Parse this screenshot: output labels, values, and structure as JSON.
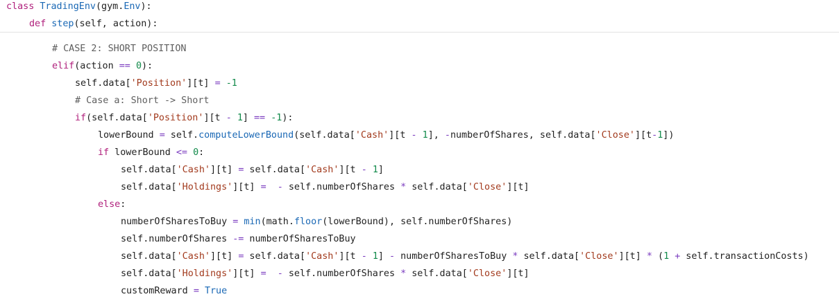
{
  "sticky_header": [
    {
      "indent": 0,
      "tokens": [
        {
          "t": "kw",
          "v": "class"
        },
        {
          "t": "tx",
          "v": " "
        },
        {
          "t": "fn",
          "v": "TradingEnv"
        },
        {
          "t": "tx",
          "v": "(gym."
        },
        {
          "t": "fn",
          "v": "Env"
        },
        {
          "t": "tx",
          "v": "):"
        }
      ]
    },
    {
      "indent": 1,
      "tokens": [
        {
          "t": "kw",
          "v": "def"
        },
        {
          "t": "tx",
          "v": " "
        },
        {
          "t": "fn",
          "v": "step"
        },
        {
          "t": "tx",
          "v": "(self, action):"
        }
      ]
    }
  ],
  "body_lines": [
    {
      "indent": 2,
      "tokens": [
        {
          "t": "cm",
          "v": "# CASE 2: SHORT POSITION"
        }
      ]
    },
    {
      "indent": 2,
      "tokens": [
        {
          "t": "kw",
          "v": "elif"
        },
        {
          "t": "tx",
          "v": "(action "
        },
        {
          "t": "op",
          "v": "=="
        },
        {
          "t": "tx",
          "v": " "
        },
        {
          "t": "num",
          "v": "0"
        },
        {
          "t": "tx",
          "v": "):"
        }
      ]
    },
    {
      "indent": 3,
      "tokens": [
        {
          "t": "tx",
          "v": "self.data["
        },
        {
          "t": "str",
          "v": "'Position'"
        },
        {
          "t": "tx",
          "v": "][t] "
        },
        {
          "t": "op",
          "v": "="
        },
        {
          "t": "tx",
          "v": " "
        },
        {
          "t": "num",
          "v": "-1"
        }
      ]
    },
    {
      "indent": 3,
      "tokens": [
        {
          "t": "cm",
          "v": "# Case a: Short -> Short"
        }
      ]
    },
    {
      "indent": 3,
      "tokens": [
        {
          "t": "kw",
          "v": "if"
        },
        {
          "t": "tx",
          "v": "(self.data["
        },
        {
          "t": "str",
          "v": "'Position'"
        },
        {
          "t": "tx",
          "v": "][t "
        },
        {
          "t": "op",
          "v": "-"
        },
        {
          "t": "tx",
          "v": " "
        },
        {
          "t": "num",
          "v": "1"
        },
        {
          "t": "tx",
          "v": "] "
        },
        {
          "t": "op",
          "v": "=="
        },
        {
          "t": "tx",
          "v": " "
        },
        {
          "t": "num",
          "v": "-1"
        },
        {
          "t": "tx",
          "v": "):"
        }
      ]
    },
    {
      "indent": 4,
      "tokens": [
        {
          "t": "tx",
          "v": "lowerBound "
        },
        {
          "t": "op",
          "v": "="
        },
        {
          "t": "tx",
          "v": " self."
        },
        {
          "t": "fn",
          "v": "computeLowerBound"
        },
        {
          "t": "tx",
          "v": "(self.data["
        },
        {
          "t": "str",
          "v": "'Cash'"
        },
        {
          "t": "tx",
          "v": "][t "
        },
        {
          "t": "op",
          "v": "-"
        },
        {
          "t": "tx",
          "v": " "
        },
        {
          "t": "num",
          "v": "1"
        },
        {
          "t": "tx",
          "v": "], "
        },
        {
          "t": "op",
          "v": "-"
        },
        {
          "t": "tx",
          "v": "numberOfShares, self.data["
        },
        {
          "t": "str",
          "v": "'Close'"
        },
        {
          "t": "tx",
          "v": "][t"
        },
        {
          "t": "op",
          "v": "-"
        },
        {
          "t": "num",
          "v": "1"
        },
        {
          "t": "tx",
          "v": "])"
        }
      ]
    },
    {
      "indent": 4,
      "tokens": [
        {
          "t": "kw",
          "v": "if"
        },
        {
          "t": "tx",
          "v": " lowerBound "
        },
        {
          "t": "op",
          "v": "<="
        },
        {
          "t": "tx",
          "v": " "
        },
        {
          "t": "num",
          "v": "0"
        },
        {
          "t": "tx",
          "v": ":"
        }
      ]
    },
    {
      "indent": 5,
      "tokens": [
        {
          "t": "tx",
          "v": "self.data["
        },
        {
          "t": "str",
          "v": "'Cash'"
        },
        {
          "t": "tx",
          "v": "][t] "
        },
        {
          "t": "op",
          "v": "="
        },
        {
          "t": "tx",
          "v": " self.data["
        },
        {
          "t": "str",
          "v": "'Cash'"
        },
        {
          "t": "tx",
          "v": "][t "
        },
        {
          "t": "op",
          "v": "-"
        },
        {
          "t": "tx",
          "v": " "
        },
        {
          "t": "num",
          "v": "1"
        },
        {
          "t": "tx",
          "v": "]"
        }
      ]
    },
    {
      "indent": 5,
      "tokens": [
        {
          "t": "tx",
          "v": "self.data["
        },
        {
          "t": "str",
          "v": "'Holdings'"
        },
        {
          "t": "tx",
          "v": "][t] "
        },
        {
          "t": "op",
          "v": "="
        },
        {
          "t": "tx",
          "v": "  "
        },
        {
          "t": "op",
          "v": "-"
        },
        {
          "t": "tx",
          "v": " self.numberOfShares "
        },
        {
          "t": "op",
          "v": "*"
        },
        {
          "t": "tx",
          "v": " self.data["
        },
        {
          "t": "str",
          "v": "'Close'"
        },
        {
          "t": "tx",
          "v": "][t]"
        }
      ]
    },
    {
      "indent": 4,
      "tokens": [
        {
          "t": "kw",
          "v": "else"
        },
        {
          "t": "tx",
          "v": ":"
        }
      ]
    },
    {
      "indent": 5,
      "tokens": [
        {
          "t": "tx",
          "v": "numberOfSharesToBuy "
        },
        {
          "t": "op",
          "v": "="
        },
        {
          "t": "tx",
          "v": " "
        },
        {
          "t": "fn",
          "v": "min"
        },
        {
          "t": "tx",
          "v": "(math."
        },
        {
          "t": "fn",
          "v": "floor"
        },
        {
          "t": "tx",
          "v": "(lowerBound), self.numberOfShares)"
        }
      ]
    },
    {
      "indent": 5,
      "tokens": [
        {
          "t": "tx",
          "v": "self.numberOfShares "
        },
        {
          "t": "op",
          "v": "-="
        },
        {
          "t": "tx",
          "v": " numberOfSharesToBuy"
        }
      ]
    },
    {
      "indent": 5,
      "tokens": [
        {
          "t": "tx",
          "v": "self.data["
        },
        {
          "t": "str",
          "v": "'Cash'"
        },
        {
          "t": "tx",
          "v": "][t] "
        },
        {
          "t": "op",
          "v": "="
        },
        {
          "t": "tx",
          "v": " self.data["
        },
        {
          "t": "str",
          "v": "'Cash'"
        },
        {
          "t": "tx",
          "v": "][t "
        },
        {
          "t": "op",
          "v": "-"
        },
        {
          "t": "tx",
          "v": " "
        },
        {
          "t": "num",
          "v": "1"
        },
        {
          "t": "tx",
          "v": "] "
        },
        {
          "t": "op",
          "v": "-"
        },
        {
          "t": "tx",
          "v": " numberOfSharesToBuy "
        },
        {
          "t": "op",
          "v": "*"
        },
        {
          "t": "tx",
          "v": " self.data["
        },
        {
          "t": "str",
          "v": "'Close'"
        },
        {
          "t": "tx",
          "v": "][t] "
        },
        {
          "t": "op",
          "v": "*"
        },
        {
          "t": "tx",
          "v": " ("
        },
        {
          "t": "num",
          "v": "1"
        },
        {
          "t": "tx",
          "v": " "
        },
        {
          "t": "op",
          "v": "+"
        },
        {
          "t": "tx",
          "v": " self.transactionCosts)"
        }
      ]
    },
    {
      "indent": 5,
      "tokens": [
        {
          "t": "tx",
          "v": "self.data["
        },
        {
          "t": "str",
          "v": "'Holdings'"
        },
        {
          "t": "tx",
          "v": "][t] "
        },
        {
          "t": "op",
          "v": "="
        },
        {
          "t": "tx",
          "v": "  "
        },
        {
          "t": "op",
          "v": "-"
        },
        {
          "t": "tx",
          "v": " self.numberOfShares "
        },
        {
          "t": "op",
          "v": "*"
        },
        {
          "t": "tx",
          "v": " self.data["
        },
        {
          "t": "str",
          "v": "'Close'"
        },
        {
          "t": "tx",
          "v": "][t]"
        }
      ]
    },
    {
      "indent": 5,
      "tokens": [
        {
          "t": "tx",
          "v": "customReward "
        },
        {
          "t": "op",
          "v": "="
        },
        {
          "t": "tx",
          "v": " "
        },
        {
          "t": "bool",
          "v": "True"
        }
      ]
    }
  ]
}
